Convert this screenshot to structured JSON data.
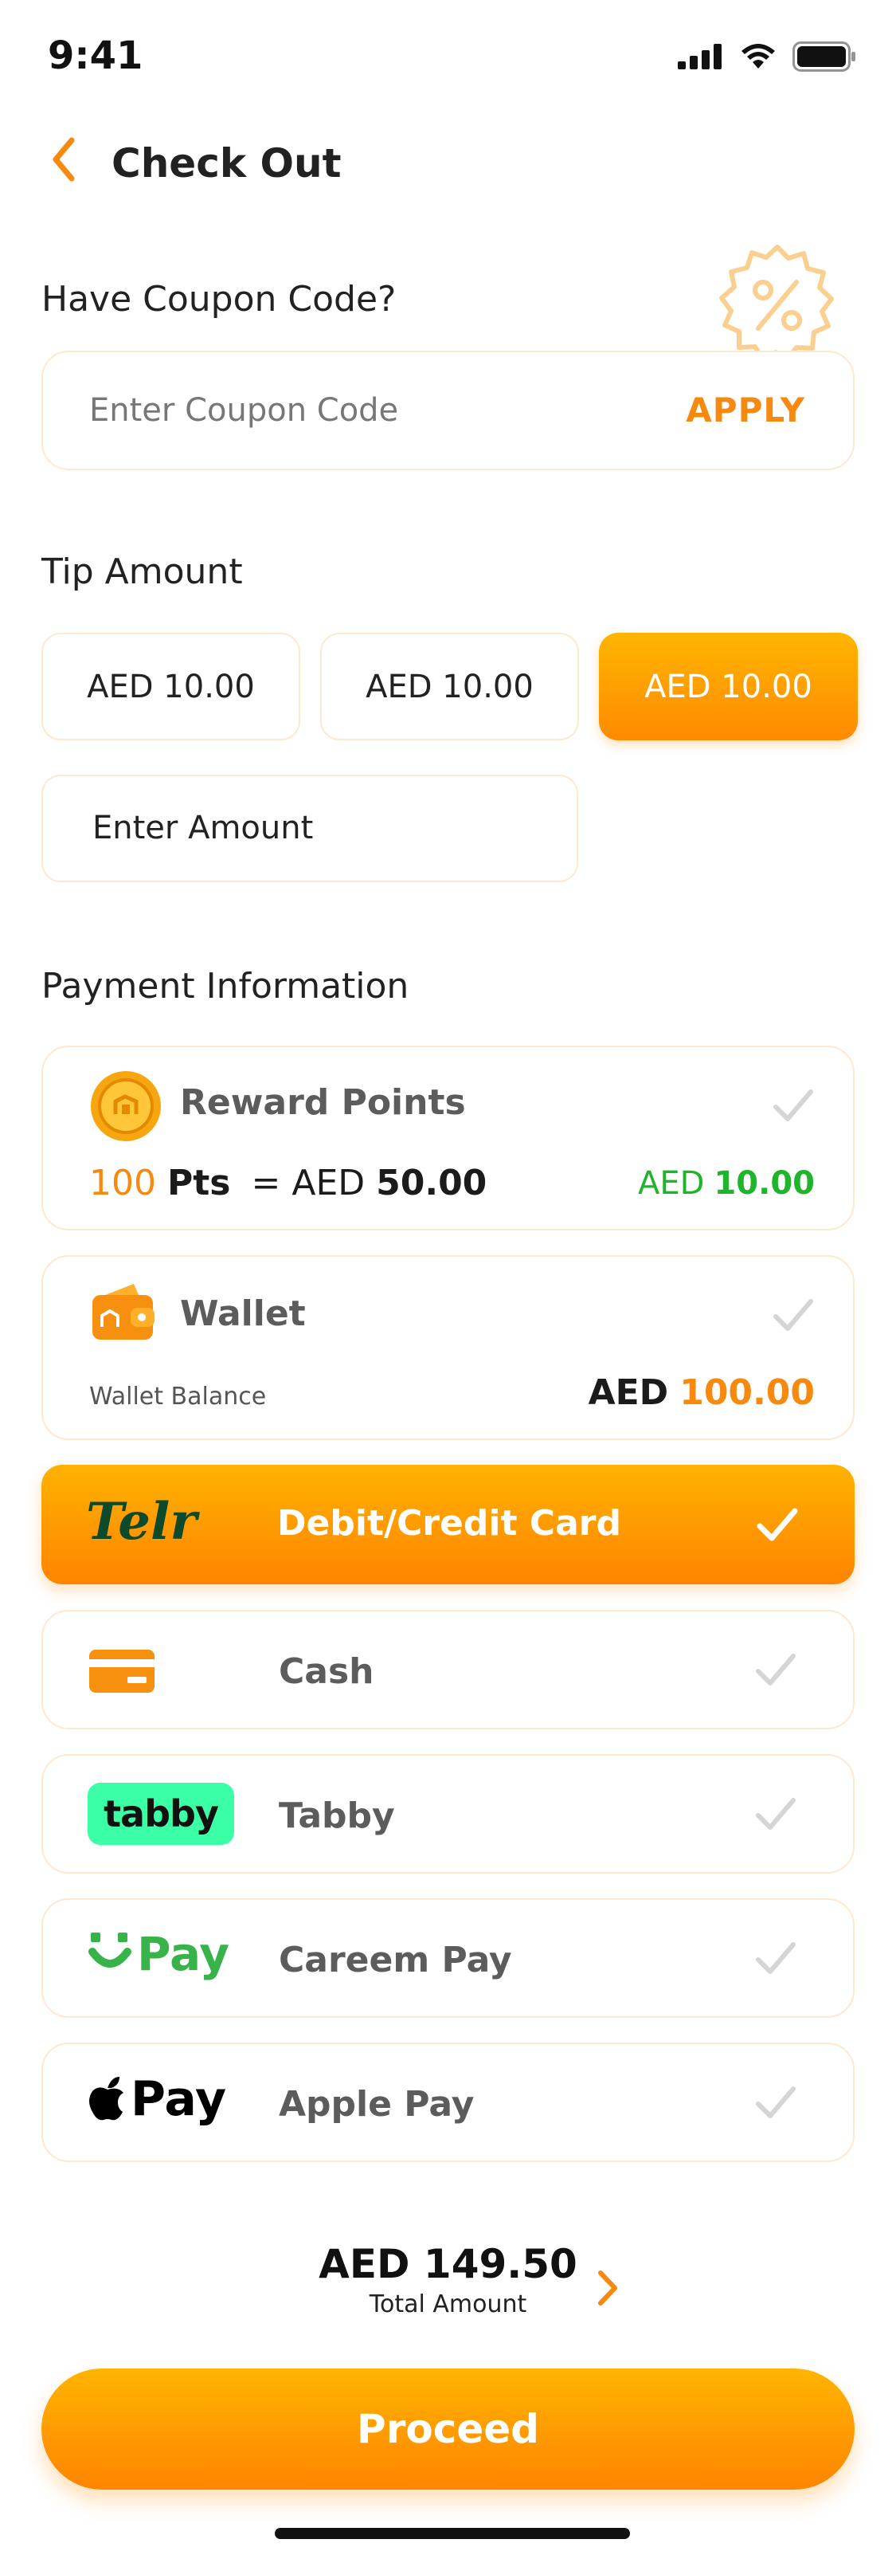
{
  "status_bar": {
    "time": "9:41"
  },
  "header": {
    "title": "Check Out"
  },
  "coupon": {
    "label": "Have Coupon Code?",
    "placeholder": "Enter Coupon Code",
    "apply_label": "APPLY"
  },
  "tip": {
    "label": "Tip Amount",
    "options": [
      "AED 10.00",
      "AED 10.00",
      "AED 10.00"
    ],
    "selected_index": 2,
    "custom_placeholder": "Enter Amount"
  },
  "payment": {
    "label": "Payment Information",
    "reward": {
      "title": "Reward Points",
      "points_value": "100",
      "points_unit": "Pts",
      "equals": "=",
      "currency": "AED",
      "points_amount": "50.00",
      "applied_currency": "AED",
      "applied_amount": "10.00"
    },
    "wallet": {
      "title": "Wallet",
      "balance_label": "Wallet Balance",
      "currency": "AED",
      "balance": "100.00"
    },
    "methods": [
      {
        "logo": "Telr",
        "label": "Debit/Credit Card",
        "selected": true
      },
      {
        "logo": "card-icon",
        "label": "Cash",
        "selected": false
      },
      {
        "logo": "tabby",
        "label": "Tabby",
        "selected": false
      },
      {
        "logo": "Pay",
        "label": "Careem Pay",
        "selected": false
      },
      {
        "logo": "Pay",
        "label": "Apple Pay",
        "selected": false
      }
    ]
  },
  "total": {
    "amount": "AED 149.50",
    "label": "Total Amount"
  },
  "proceed_label": "Proceed",
  "colors": {
    "accent": "#ff9500",
    "green": "#1fb52a",
    "tabby": "#3bffa6",
    "careem": "#37b34a"
  }
}
